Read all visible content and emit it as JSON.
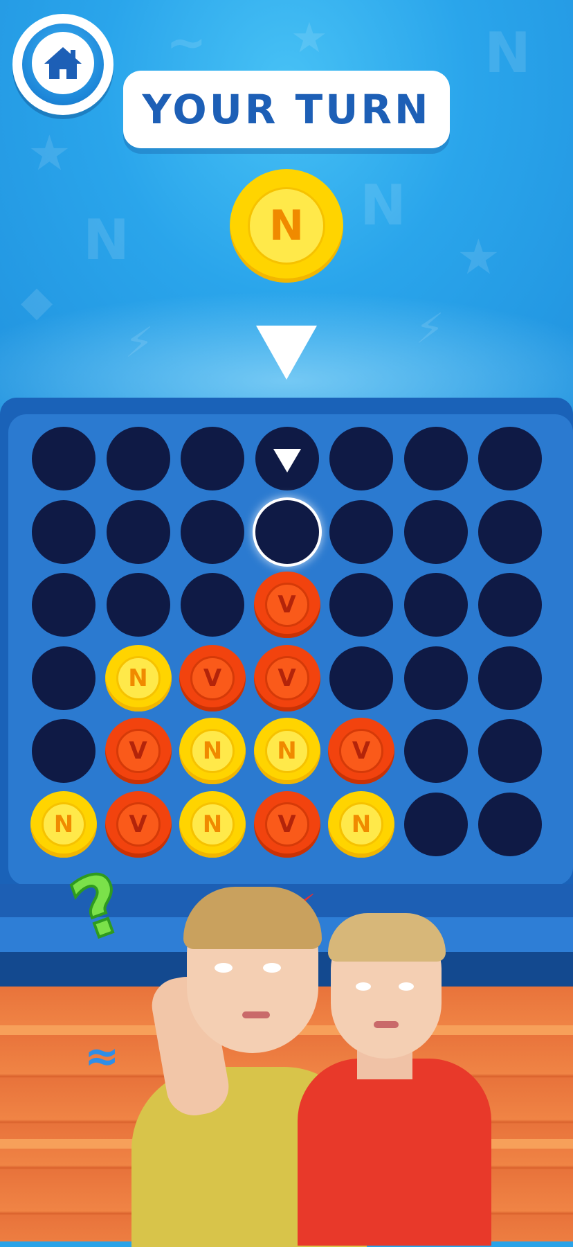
{
  "header": {
    "home_icon": "home-icon",
    "turn_text": "YOUR TURN"
  },
  "current_coin": {
    "color": "yellow",
    "letter": "N"
  },
  "colors": {
    "yellow": "#ffd400",
    "red": "#f2430e",
    "board": "#2b7ad0",
    "hole": "#0f1a45",
    "banner_text": "#1d5fb6"
  },
  "coin_letters": {
    "yellow": "N",
    "red": "V"
  },
  "board": {
    "columns": 7,
    "rows": 6,
    "selected_column": 3,
    "selected_row": 1,
    "grid": [
      [
        "",
        "",
        "",
        "",
        "",
        "",
        ""
      ],
      [
        "",
        "",
        "",
        "",
        "",
        "",
        ""
      ],
      [
        "",
        "",
        "",
        "R",
        "",
        "",
        ""
      ],
      [
        "",
        "Y",
        "R",
        "R",
        "",
        "",
        ""
      ],
      [
        "",
        "R",
        "Y",
        "Y",
        "R",
        "",
        ""
      ],
      [
        "Y",
        "R",
        "Y",
        "R",
        "Y",
        "",
        ""
      ]
    ]
  }
}
